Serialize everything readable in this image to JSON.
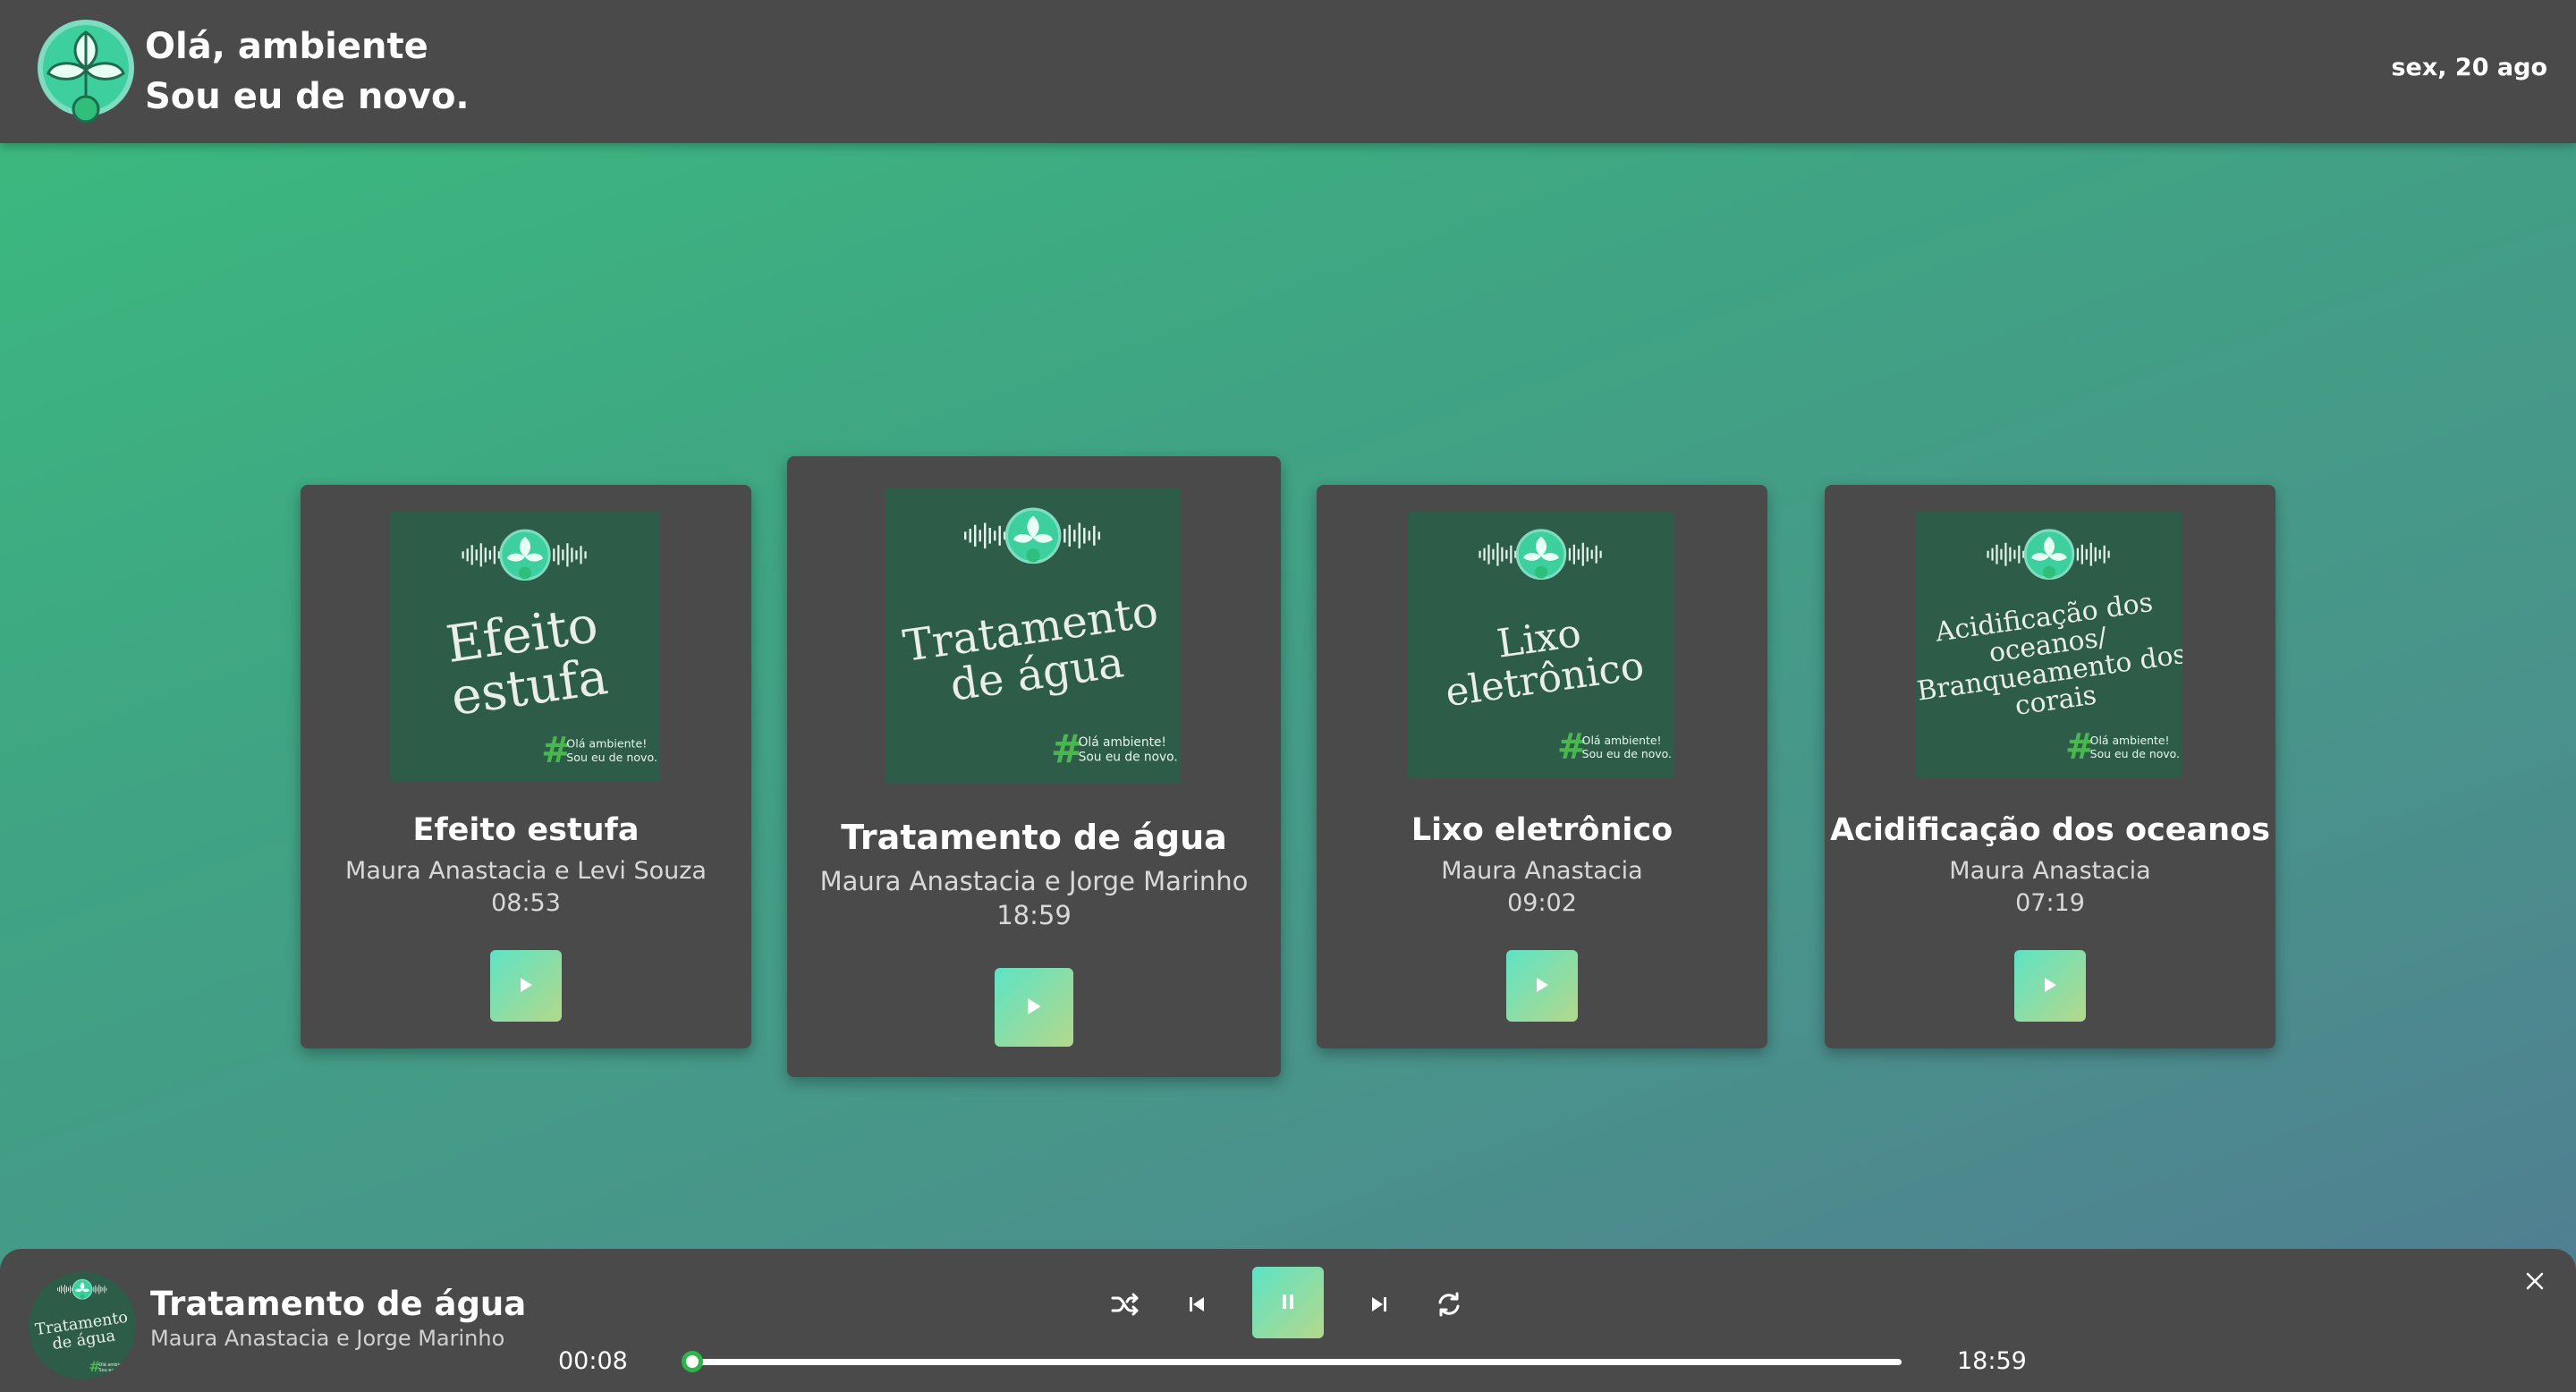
{
  "header": {
    "brand_line1": "Olá, ambiente",
    "brand_line2": "Sou eu de novo.",
    "date": "sex, 20 ago",
    "logo_icon": "leaf-microphone-logo"
  },
  "cards": [
    {
      "cover_text_lines": [
        "Efeito",
        "estufa"
      ],
      "title": "Efeito estufa",
      "authors": "Maura Anastacia e Levi Souza",
      "duration": "08:53"
    },
    {
      "cover_text_lines": [
        "Tratamento",
        "de água"
      ],
      "title": "Tratamento de água",
      "authors": "Maura Anastacia e Jorge Marinho",
      "duration": "18:59"
    },
    {
      "cover_text_lines": [
        "Lixo",
        "eletrônico"
      ],
      "title": "Lixo eletrônico",
      "authors": "Maura Anastacia",
      "duration": "09:02"
    },
    {
      "cover_text_lines": [
        "Acidificação dos",
        "oceanos/",
        "Branqueamento dos",
        "corais"
      ],
      "title": "Acidificação dos oceanos",
      "authors": "Maura Anastacia",
      "duration": "07:19"
    }
  ],
  "cover_branding": {
    "line1": "Olá ambiente!",
    "line2": "Sou eu de novo.",
    "hash": "#"
  },
  "player": {
    "cover_text_lines": [
      "Tratamento",
      "de água"
    ],
    "title": "Tratamento de água",
    "authors": "Maura Anastacia e Jorge Marinho",
    "current_time": "00:08",
    "total_time": "18:59",
    "progress_fraction": 0.007,
    "state": "playing"
  },
  "colors": {
    "panel": "#4a4a4a",
    "cover_bg": "#2d5d48",
    "accent_start": "#5ee3c4",
    "accent_end": "#b4d88c",
    "progress_knob_ring": "#2fb34a"
  }
}
